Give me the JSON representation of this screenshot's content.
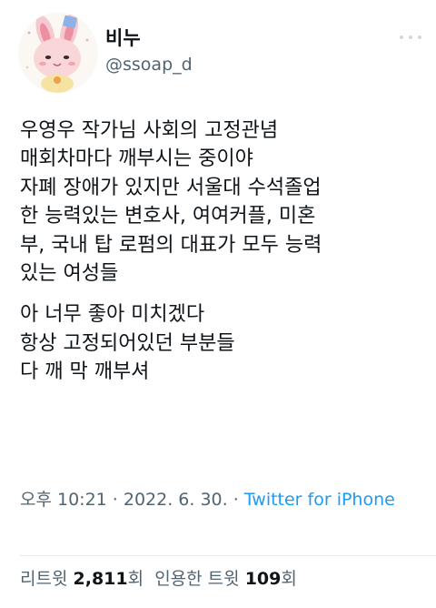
{
  "author": {
    "display_name": "비누",
    "handle": "@ssoap_d",
    "avatar_icon": "bunny-character-avatar"
  },
  "tweet": {
    "paragraphs": [
      {
        "lines": [
          "우영우 작가님 사회의 고정관념",
          "매회차마다 깨부시는 중이야",
          "자폐 장애가 있지만 서울대 수석졸업",
          "한 능력있는 변호사, 여여커플, 미혼",
          "부, 국내 탑 로펌의 대표가 모두 능력",
          "있는 여성들"
        ]
      },
      {
        "lines": [
          "아 너무 좋아 미치겠다",
          "항상 고정되어있던 부분들",
          "다 깨 막 깨부셔"
        ]
      }
    ]
  },
  "meta": {
    "timestamp": "오후 10:21 · 2022. 6. 30. · ",
    "source": "Twitter for iPhone",
    "source_color": "#1d9bf0"
  },
  "stats": {
    "retweets_label": "리트윗",
    "retweets_count": "2,811",
    "retweets_unit": "회",
    "quotes_label": "인용한 트윗",
    "quotes_count": "109",
    "quotes_unit": "회"
  },
  "icons": {
    "more": "more-dots-icon"
  }
}
